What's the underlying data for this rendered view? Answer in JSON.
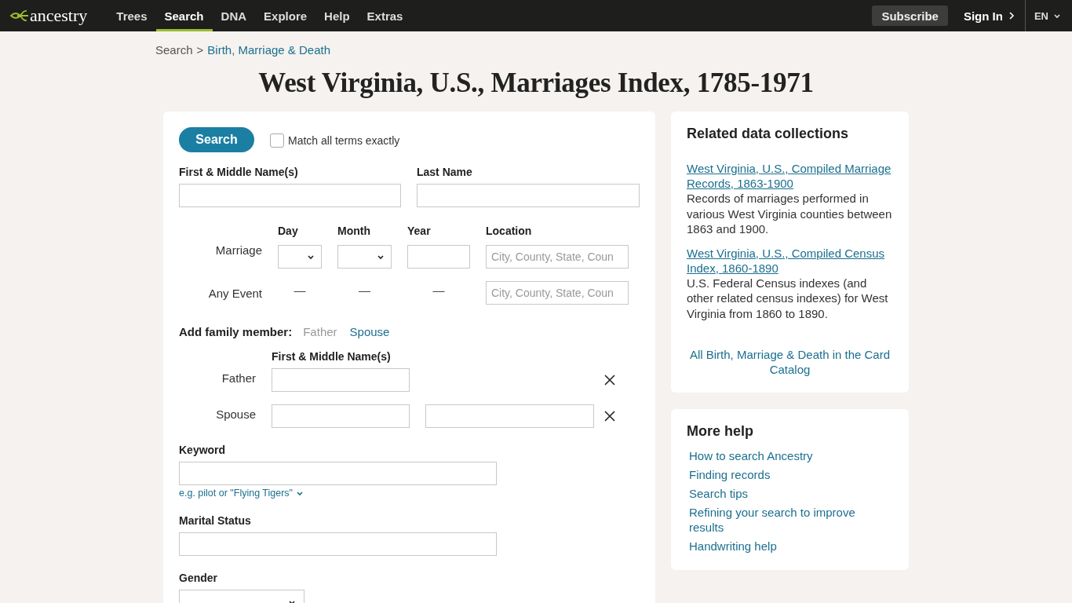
{
  "nav": {
    "logo": "ancestry",
    "items": [
      {
        "label": "Trees",
        "selected": false
      },
      {
        "label": "Search",
        "selected": true
      },
      {
        "label": "DNA",
        "selected": false
      },
      {
        "label": "Explore",
        "selected": false
      },
      {
        "label": "Help",
        "selected": false
      },
      {
        "label": "Extras",
        "selected": false
      }
    ],
    "subscribe": "Subscribe",
    "sign_in": "Sign In",
    "language": "EN"
  },
  "breadcrumb": {
    "root": "Search",
    "separator": ">",
    "current": "Birth, Marriage & Death"
  },
  "title": "West Virginia, U.S., Marriages Index, 1785-1971",
  "form": {
    "search_button": "Search",
    "exact": {
      "label": "Match all terms exactly",
      "checked": false
    },
    "first_name_label": "First & Middle Name(s)",
    "last_name_label": "Last Name",
    "event_headers": [
      "Day",
      "Month",
      "Year",
      "Location"
    ],
    "events": [
      {
        "label": "Marriage",
        "kind": "inputs",
        "location_placeholder": "City, County, State, Coun"
      },
      {
        "label": "Any Event",
        "kind": "dashes",
        "dashes": [
          "—",
          "—",
          "—"
        ],
        "location_placeholder": "City, County, State, Coun"
      }
    ],
    "add_family": {
      "label": "Add family member:",
      "options": [
        {
          "label": "Father",
          "disabled": true
        },
        {
          "label": "Spouse",
          "disabled": false
        }
      ]
    },
    "family": {
      "header": "First & Middle Name(s)",
      "members": [
        {
          "label": "Father",
          "last_name_field": false
        },
        {
          "label": "Spouse",
          "last_name_field": true
        }
      ]
    },
    "keyword": {
      "label": "Keyword",
      "hint": "e.g. pilot or \"Flying Tigers\""
    },
    "marital_status": {
      "label": "Marital Status"
    },
    "gender": {
      "label": "Gender"
    }
  },
  "related": {
    "title": "Related data collections",
    "items": [
      {
        "link": "West Virginia, U.S., Compiled Marriage Records, 1863-1900",
        "description": "Records of marriages performed in various West Virginia counties between 1863 and 1900."
      },
      {
        "link": "West Virginia, U.S., Compiled Census Index, 1860-1890",
        "description": "U.S. Federal Census indexes (and other related census indexes) for West Virginia from 1860 to 1890."
      }
    ],
    "catalog_link": "All Birth, Marriage & Death in the Card Catalog"
  },
  "help": {
    "title": "More help",
    "links": [
      "How to search Ancestry",
      "Finding records",
      "Search tips",
      "Refining your search to improve results",
      "Handwriting help"
    ]
  }
}
